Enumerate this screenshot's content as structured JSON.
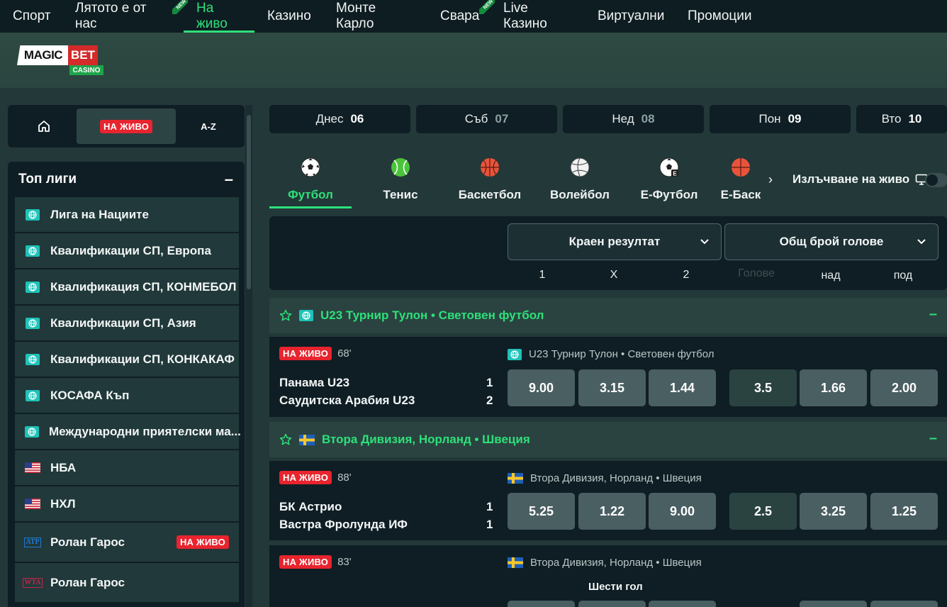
{
  "topnav": [
    {
      "label": "Спорт",
      "active": false,
      "new": false,
      "w": 88
    },
    {
      "label": "Лятото е от нас",
      "active": false,
      "new": true,
      "w": 171
    },
    {
      "label": "На живо",
      "active": true,
      "new": false,
      "w": 100
    },
    {
      "label": "Казино",
      "active": false,
      "new": false,
      "w": 97
    },
    {
      "label": "Монте Карло",
      "active": false,
      "new": false,
      "w": 147
    },
    {
      "label": "Свара",
      "active": false,
      "new": true,
      "w": 89
    },
    {
      "label": "Live Казино",
      "active": false,
      "new": false,
      "w": 133
    },
    {
      "label": "Виртуални",
      "active": false,
      "new": false,
      "w": 127
    },
    {
      "label": "Промоции",
      "active": false,
      "new": false,
      "w": 120
    }
  ],
  "new_ribbon_text": "NEW",
  "logo": {
    "magic": "MAGIC",
    "bet": "BET",
    "casino": "CASINO"
  },
  "left": {
    "live_label": "НА ЖИВО",
    "az_label": "A-Z",
    "top_leagues_title": "Топ лиги",
    "collapse": "–",
    "leagues": [
      {
        "name": "Лига на Нациите",
        "icon": "globe-icon"
      },
      {
        "name": "Квалификации СП, Европа",
        "icon": "globe-icon"
      },
      {
        "name": "Квалификация СП, КОНМЕБОЛ",
        "icon": "globe-icon"
      },
      {
        "name": "Квалификации СП, Азия",
        "icon": "globe-icon"
      },
      {
        "name": "Квалификации СП, КОНКАКАФ",
        "icon": "globe-icon"
      },
      {
        "name": "КОСАФА Къп",
        "icon": "globe-icon"
      },
      {
        "name": "Международни приятелски ма...",
        "icon": "globe-icon"
      },
      {
        "name": "НБА",
        "icon": "us-flag-icon"
      },
      {
        "name": "НХЛ",
        "icon": "us-flag-icon"
      },
      {
        "name": "Ролан Гарос",
        "icon": "atp-icon",
        "live": "НА ЖИВО"
      },
      {
        "name": "Ролан Гарос",
        "icon": "wta-icon"
      }
    ],
    "atp": "ATP",
    "wta": "WTA"
  },
  "days": [
    {
      "label": "Днес",
      "num": "06",
      "muted": false
    },
    {
      "label": "Съб",
      "num": "07",
      "muted": true
    },
    {
      "label": "Нед",
      "num": "08",
      "muted": true
    },
    {
      "label": "Пон",
      "num": "09",
      "muted": false
    },
    {
      "label": "Вто",
      "num": "10",
      "muted": false
    }
  ],
  "sports": [
    {
      "label": "Футбол",
      "icon": "soccer-ball-icon",
      "active": true
    },
    {
      "label": "Тенис",
      "icon": "tennis-ball-icon",
      "active": false
    },
    {
      "label": "Баскетбол",
      "icon": "basketball-icon",
      "active": false
    },
    {
      "label": "Волейбол",
      "icon": "volleyball-icon",
      "active": false
    },
    {
      "label": "Е-Футбол",
      "icon": "e-soccer-icon",
      "active": false
    },
    {
      "label": "Е-Баск",
      "icon": "e-basketball-icon",
      "active": false
    }
  ],
  "stream_label": "Излъчване на живо",
  "markets": {
    "select1": "Краен резултат",
    "select2": "Общ брой голове",
    "cols1": [
      "1",
      "X",
      "2"
    ],
    "goals": "Голове",
    "cols2": [
      "над",
      "под"
    ]
  },
  "sections": [
    {
      "league": "U23 Турнир Тулон • Световен футбол",
      "flag": "globe-icon",
      "events": [
        {
          "live": "НА ЖИВО",
          "minute": "68'",
          "league": "U23 Турнир Тулон • Световен футбол",
          "home": "Панама U23",
          "away": "Саудитска Арабия U23",
          "home_score": "1",
          "away_score": "2",
          "odds": [
            "9.00",
            "3.15",
            "1.44"
          ],
          "line": "3.5",
          "over": "1.66",
          "under": "2.00"
        }
      ]
    },
    {
      "league": "Втора Дивизия, Норланд • Швеция",
      "flag": "sweden-flag-icon",
      "events": [
        {
          "live": "НА ЖИВО",
          "minute": "88'",
          "league": "Втора Дивизия, Норланд • Швеция",
          "home": "БК Астрио",
          "away": "Вастра Фролунда ИФ",
          "home_score": "1",
          "away_score": "1",
          "odds": [
            "5.25",
            "1.22",
            "9.00"
          ],
          "line": "2.5",
          "over": "3.25",
          "under": "1.25"
        },
        {
          "live": "НА ЖИВО",
          "minute": "83'",
          "league": "Втора Дивизия, Норланд • Швеция",
          "sixth_goal": "Шести гол"
        }
      ]
    }
  ],
  "colors": {
    "accent": "#2ee07a",
    "live": "#e8242e",
    "bg": "#233838",
    "panel": "#0f1e24"
  }
}
